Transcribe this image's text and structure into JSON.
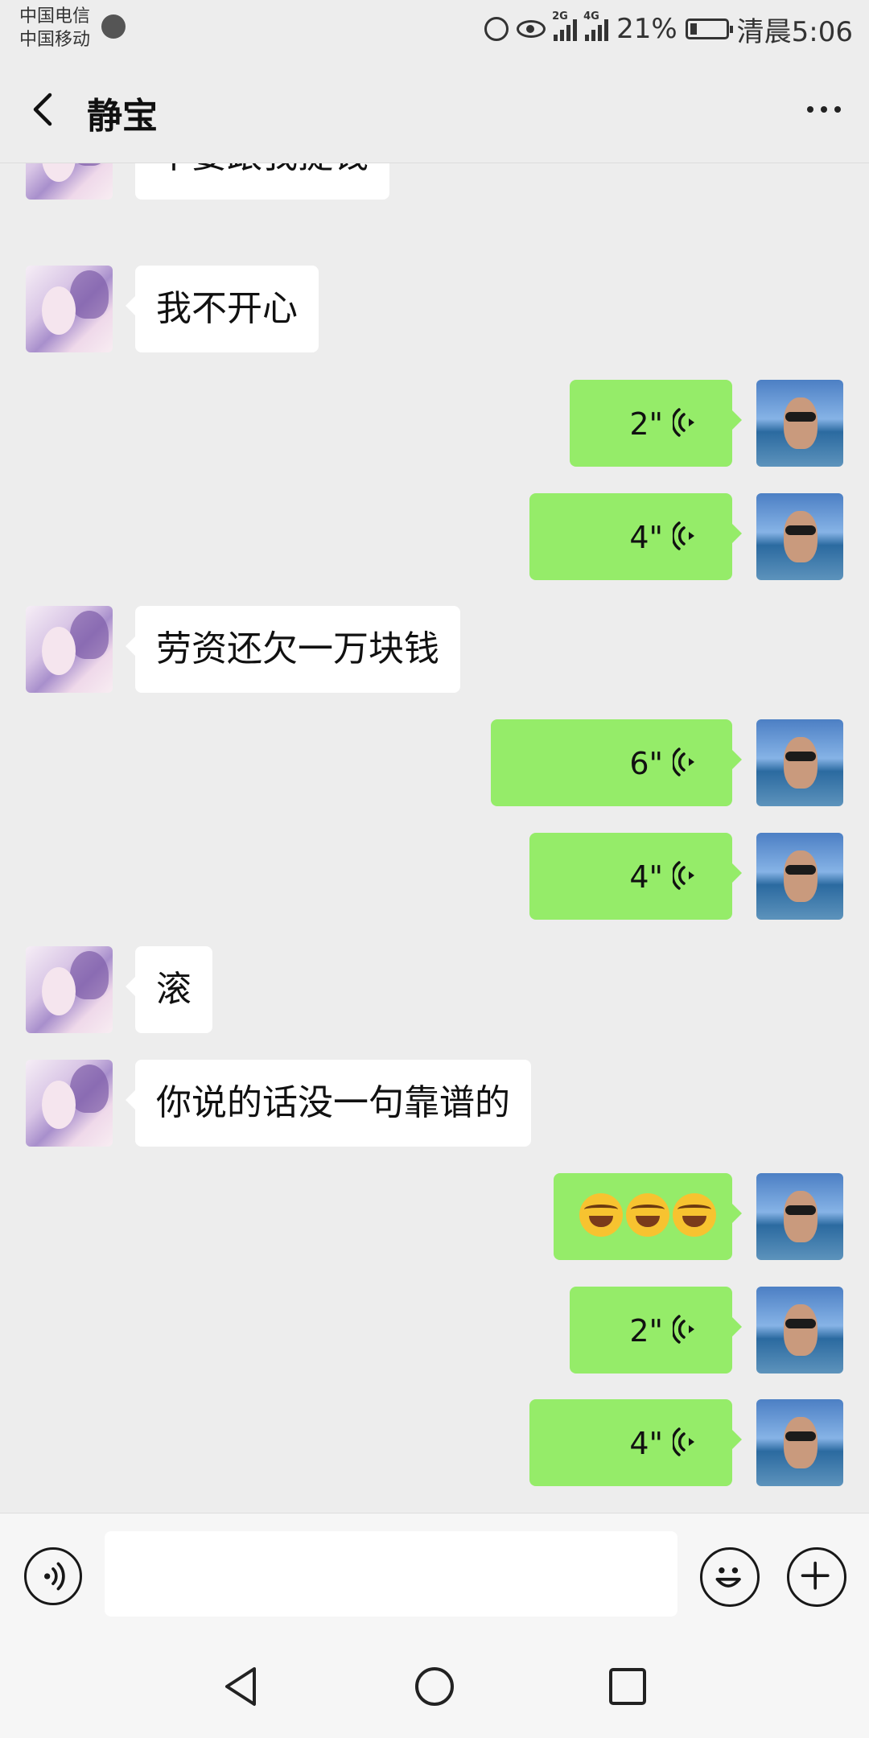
{
  "status_bar": {
    "carrier_1": "中国电信",
    "carrier_2": "中国移动",
    "net_2g": "2G",
    "net_4g": "4G",
    "battery": "21%",
    "time": "清晨5:06",
    "battery_level": 0.21
  },
  "header": {
    "title": "静宝",
    "back_icon": "chevron-left-icon",
    "more_icon": "more-dots-icon"
  },
  "messages": [
    {
      "side": "left",
      "type": "text",
      "text": "不要跟我提钱"
    },
    {
      "side": "left",
      "type": "text",
      "text": "我不开心"
    },
    {
      "side": "right",
      "type": "voice",
      "duration": "2\""
    },
    {
      "side": "right",
      "type": "voice",
      "duration": "4\""
    },
    {
      "side": "left",
      "type": "text",
      "text": "劳资还欠一万块钱"
    },
    {
      "side": "right",
      "type": "voice",
      "duration": "6\""
    },
    {
      "side": "right",
      "type": "voice",
      "duration": "4\""
    },
    {
      "side": "left",
      "type": "text",
      "text": "滚"
    },
    {
      "side": "left",
      "type": "text",
      "text": "你说的话没一句靠谱的"
    },
    {
      "side": "right",
      "type": "emoji",
      "count": 3,
      "emoji_name": "facepalm-laughing-emoji"
    },
    {
      "side": "right",
      "type": "voice",
      "duration": "2\""
    },
    {
      "side": "right",
      "type": "voice",
      "duration": "4\""
    }
  ],
  "input_bar": {
    "value": "",
    "voice_icon": "voice-mode-icon",
    "emoji_icon": "smiley-icon",
    "plus_icon": "plus-circle-icon"
  },
  "nav_bar": {
    "back_icon": "triangle-back-icon",
    "home_icon": "circle-home-icon",
    "recents_icon": "square-recents-icon"
  },
  "colors": {
    "background": "#ededed",
    "outgoing_bubble": "#95ec69",
    "incoming_bubble": "#ffffff"
  }
}
